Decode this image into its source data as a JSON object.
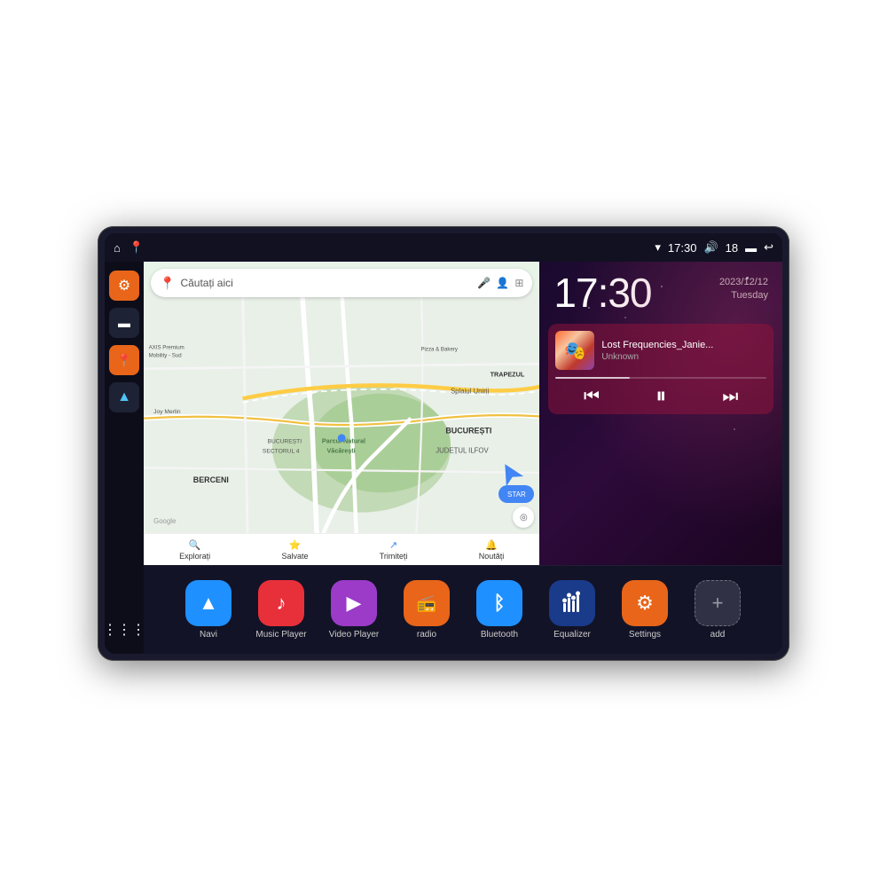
{
  "device": {
    "status_bar": {
      "wifi_icon": "▾",
      "time": "17:30",
      "volume_icon": "🔊",
      "battery_level": "18",
      "battery_icon": "▬",
      "back_icon": "↩"
    },
    "sidebar": {
      "settings_label": "settings",
      "archive_label": "archive",
      "map_label": "map",
      "nav_label": "nav",
      "apps_label": "apps"
    },
    "map": {
      "search_placeholder": "Căutați aici",
      "places": [
        "AXIS Premium Mobility - Sud",
        "Pizza & Bakery",
        "Parcul Natural Văcărești",
        "BUCUREȘTI",
        "BUCUREȘTI SECTORUL 4",
        "JUDEȚUL ILFOV",
        "BERCENI",
        "TRAPEZUL"
      ],
      "bottom_items": [
        {
          "icon": "📍",
          "label": "Explorați"
        },
        {
          "icon": "⭐",
          "label": "Salvate"
        },
        {
          "icon": "↗",
          "label": "Trimiteți"
        },
        {
          "icon": "🔔",
          "label": "Noutăți"
        }
      ]
    },
    "clock": {
      "time": "17:30",
      "date": "2023/12/12",
      "day": "Tuesday"
    },
    "music": {
      "title": "Lost Frequencies_Janie...",
      "artist": "Unknown",
      "progress": 35
    },
    "apps": [
      {
        "id": "navi",
        "label": "Navi",
        "color": "blue",
        "icon": "▲"
      },
      {
        "id": "music",
        "label": "Music Player",
        "color": "red",
        "icon": "♫"
      },
      {
        "id": "video",
        "label": "Video Player",
        "color": "purple",
        "icon": "▶"
      },
      {
        "id": "radio",
        "label": "radio",
        "color": "orange",
        "icon": "📻"
      },
      {
        "id": "bluetooth",
        "label": "Bluetooth",
        "color": "blue2",
        "icon": "⚡"
      },
      {
        "id": "equalizer",
        "label": "Equalizer",
        "color": "dark-blue",
        "icon": "≡"
      },
      {
        "id": "settings",
        "label": "Settings",
        "color": "orange2",
        "icon": "⚙"
      },
      {
        "id": "add",
        "label": "add",
        "color": "gray",
        "icon": "+"
      }
    ]
  }
}
